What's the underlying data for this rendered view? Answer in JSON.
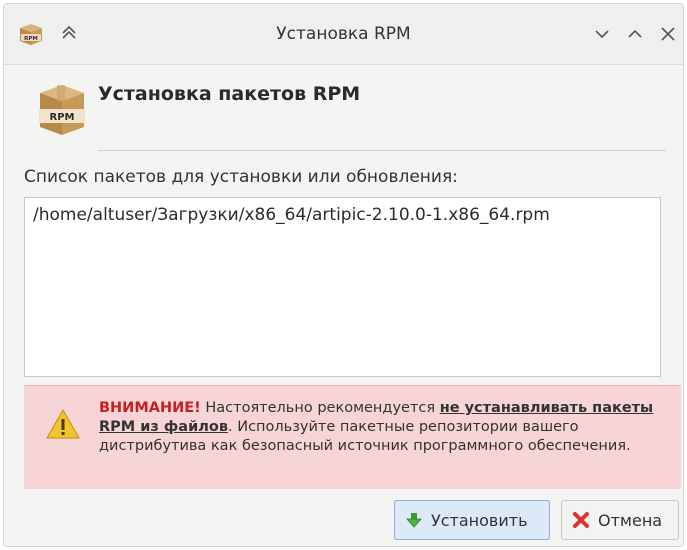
{
  "window": {
    "title": "Установка RPM",
    "app_icon": "rpm-package-icon",
    "controls": [
      "keep-above-icon",
      "minimize-icon",
      "maximize-icon",
      "close-icon"
    ]
  },
  "header": {
    "icon": "rpm-package-icon",
    "icon_text": "RPM",
    "title": "Установка пакетов RPM"
  },
  "package_list": {
    "label": "Список пакетов для установки или обновления:",
    "items": [
      "/home/altuser/Загрузки/x86_64/artipic-2.10.0-1.x86_64.rpm"
    ]
  },
  "warning": {
    "icon": "warning-icon",
    "prefix": "ВНИМАНИЕ!",
    "text_before": " Настоятельно рекомендуется ",
    "emphasis": "не устанавливать пакеты RPM из файлов",
    "text_after": ". Используйте пакетные репозитории вашего дистрибутива как безопасный источник программного обеспечения.",
    "colors": {
      "background": "#f7d4d5",
      "prefix": "#c62121"
    }
  },
  "buttons": {
    "install": {
      "label": "Установить",
      "icon": "arrow-down-icon"
    },
    "cancel": {
      "label": "Отмена",
      "icon": "red-x-icon"
    }
  }
}
